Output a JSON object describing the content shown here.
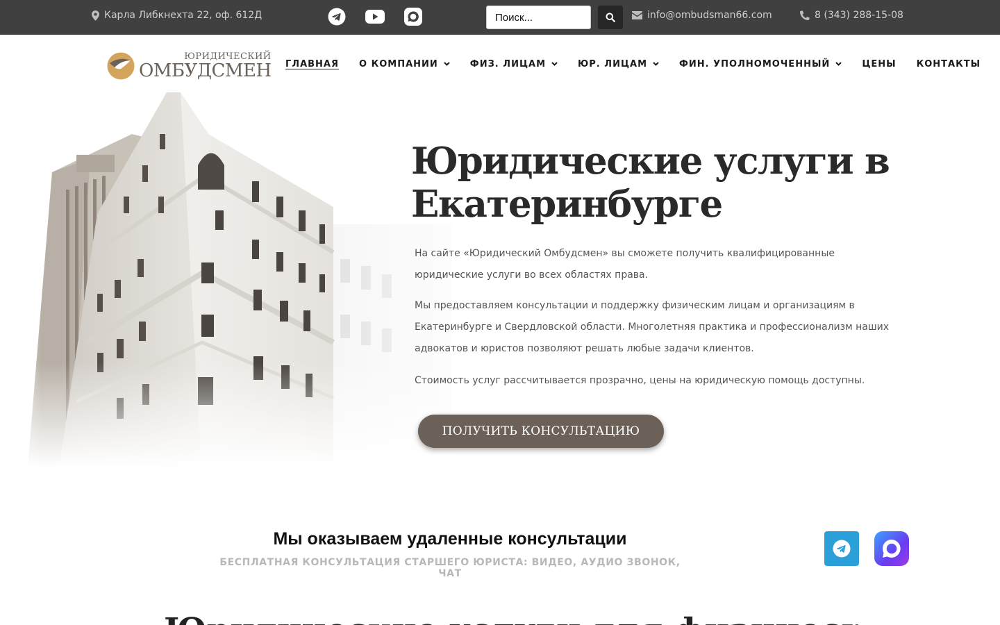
{
  "topbar": {
    "address": "Карла Либкнехта 22, оф. 612Д",
    "search_placeholder": "Поиск...",
    "email": "info@ombudsman66.com",
    "phone": "8 (343) 288-15-08"
  },
  "header": {
    "logo_small": "Юридический",
    "logo_big": "Омбудсмен",
    "nav": [
      {
        "label": "ГЛАВНАЯ"
      },
      {
        "label": "О КОМПАНИИ"
      },
      {
        "label": "ФИЗ. ЛИЦАМ"
      },
      {
        "label": "ЮР. ЛИЦАМ"
      },
      {
        "label": "ФИН. УПОЛНОМОЧЕННЫЙ"
      },
      {
        "label": "ЦЕНЫ"
      },
      {
        "label": "КОНТАКТЫ"
      }
    ]
  },
  "hero": {
    "title": "Юридические услуги в Екатеринбурге",
    "p1": "На сайте «Юридический Омбудсмен» вы сможете получить квалифицированные юридические услуги во всех областях права.",
    "p2": "Мы предоставляем консультации и поддержку физическим лицам и организациям в Екатеринбурге и Свердловской области. Многолетняя практика и профессионализм наших адвокатов и юристов позволяют решать любые задачи клиентов.",
    "p3": "Стоимость услуг рассчитывается прозрачно, цены на юридическую помощь доступны.",
    "cta": "ПОЛУЧИТЬ КОНСУЛЬТАЦИЮ"
  },
  "remote": {
    "title": "Мы оказываем удаленные консультации",
    "subtitle": "БЕСПЛАТНАЯ КОНСУЛЬТАЦИЯ СТАРШЕГО ЮРИСТА: ВИДЕО, АУДИО ЗВОНОК, ЧАТ"
  },
  "next_section": {
    "title": "Юридические услуги для физических лиц"
  },
  "colors": {
    "topbar_bg": "#404040",
    "accent_brown": "#6b6158",
    "logo_gold": "#d3a55c",
    "telegram_blue": "#2b9fd8"
  },
  "icons": [
    "map-pin-icon",
    "telegram-icon",
    "youtube-icon",
    "max-messenger-icon",
    "search-icon",
    "envelope-icon",
    "phone-icon",
    "chevron-down-icon"
  ]
}
